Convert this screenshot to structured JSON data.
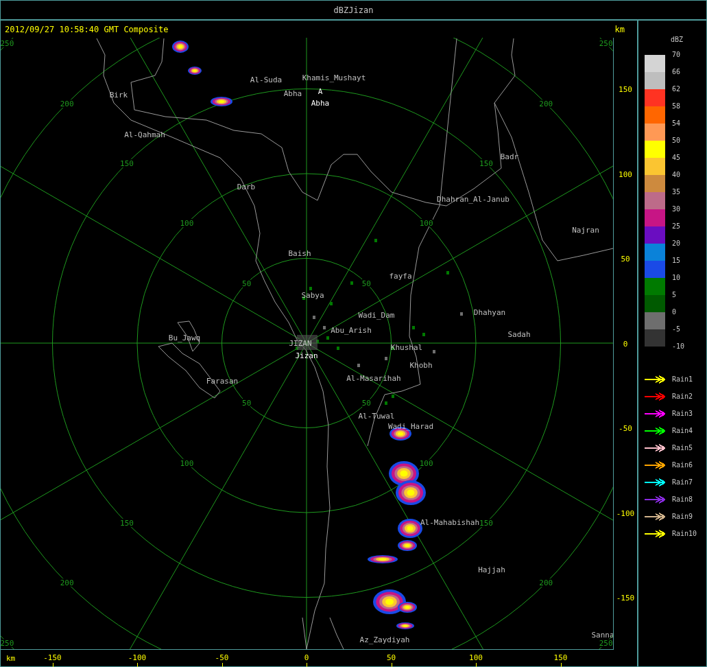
{
  "window": {
    "title": "dBZJizan"
  },
  "header": {
    "timestamp": "2012/09/27 10:58:40 GMT Composite",
    "unit": "km"
  },
  "places": [
    {
      "name": "Birk",
      "kind": "place"
    },
    {
      "name": "Al-Suda",
      "kind": "place"
    },
    {
      "name": "Khamis_Mushayt",
      "kind": "place"
    },
    {
      "name": "Abha",
      "kind": "place"
    },
    {
      "name": "A",
      "kind": "site"
    },
    {
      "name": "Abha",
      "kind": "site"
    },
    {
      "name": "Al-Qahmah",
      "kind": "place"
    },
    {
      "name": "Badr",
      "kind": "place"
    },
    {
      "name": "Darb",
      "kind": "place"
    },
    {
      "name": "Dhahran_Al-Janub",
      "kind": "place"
    },
    {
      "name": "Najran",
      "kind": "place"
    },
    {
      "name": "Baish",
      "kind": "place"
    },
    {
      "name": "fayfa",
      "kind": "place"
    },
    {
      "name": "Sabya",
      "kind": "place"
    },
    {
      "name": "Wadi_Dam",
      "kind": "place"
    },
    {
      "name": "Dhahyan",
      "kind": "place"
    },
    {
      "name": "Abu_Arish",
      "kind": "place"
    },
    {
      "name": "Sadah",
      "kind": "place"
    },
    {
      "name": "Bu_Jawq",
      "kind": "place"
    },
    {
      "name": "JIZAN",
      "kind": "place"
    },
    {
      "name": "Jizan",
      "kind": "site"
    },
    {
      "name": "Khushal",
      "kind": "place"
    },
    {
      "name": "Khobh",
      "kind": "place"
    },
    {
      "name": "Farasan",
      "kind": "place"
    },
    {
      "name": "Al-Masarihah",
      "kind": "place"
    },
    {
      "name": "Al-Tuwal",
      "kind": "place"
    },
    {
      "name": "Wadi_Harad",
      "kind": "place"
    },
    {
      "name": "Al-Mahabishah",
      "kind": "place"
    },
    {
      "name": "Hajjah",
      "kind": "place"
    },
    {
      "name": "Az_Zaydiyah",
      "kind": "place"
    },
    {
      "name": "Sanna",
      "kind": "place"
    }
  ],
  "ring_labels": [
    "50",
    "50",
    "50",
    "50",
    "100",
    "100",
    "100",
    "100",
    "150",
    "150",
    "150",
    "150",
    "200",
    "200",
    "200",
    "200",
    "250",
    "250",
    "250",
    "250"
  ],
  "y_axis": {
    "ticks": [
      "150",
      "100",
      "50",
      "0",
      "-50",
      "-100",
      "-150"
    ]
  },
  "x_axis": {
    "unit": "km",
    "ticks": [
      "-150",
      "-100",
      "-50",
      "0",
      "50",
      "100",
      "150"
    ]
  },
  "legend": {
    "title": "dBZ",
    "blocks": [
      {
        "color": "#d4d4d4"
      },
      {
        "color": "#bebebe"
      },
      {
        "color": "#ff3322"
      },
      {
        "color": "#ff6600"
      },
      {
        "color": "#ff9955"
      },
      {
        "color": "#ffff00"
      },
      {
        "color": "#fbc531"
      },
      {
        "color": "#cd8a3e"
      },
      {
        "color": "#bd6b89"
      },
      {
        "color": "#c71585"
      },
      {
        "color": "#6a0dc1"
      },
      {
        "color": "#0a82d9"
      },
      {
        "color": "#1a4ae6"
      },
      {
        "color": "#007a00"
      },
      {
        "color": "#005a00"
      },
      {
        "color": "#6e6e6e"
      },
      {
        "color": "#333333"
      }
    ],
    "labels": [
      "70",
      "66",
      "62",
      "58",
      "54",
      "50",
      "45",
      "40",
      "35",
      "30",
      "25",
      "20",
      "15",
      "10",
      "5",
      "0",
      "-5",
      "-10"
    ]
  },
  "tracks": [
    {
      "label": "Rain1",
      "color": "#ffff00"
    },
    {
      "label": "Rain2",
      "color": "#ff0000"
    },
    {
      "label": "Rain3",
      "color": "#ff00ff"
    },
    {
      "label": "Rain4",
      "color": "#00ff00"
    },
    {
      "label": "Rain5",
      "color": "#ffc0cb"
    },
    {
      "label": "Rain6",
      "color": "#ffa500"
    },
    {
      "label": "Rain7",
      "color": "#00ffff"
    },
    {
      "label": "Rain8",
      "color": "#8a2be2"
    },
    {
      "label": "Rain9",
      "color": "#d2b48c"
    },
    {
      "label": "Rain10",
      "color": "#ffff00"
    }
  ]
}
